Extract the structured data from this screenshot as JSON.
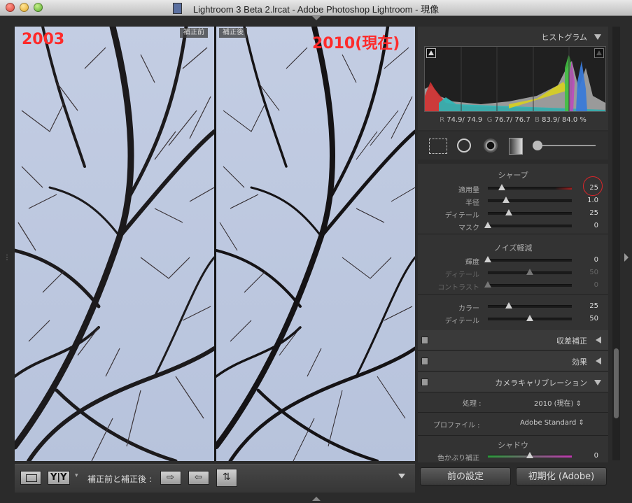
{
  "window": {
    "title": "Lightroom 3 Beta 2.lrcat - Adobe Photoshop Lightroom - 現像"
  },
  "compare": {
    "left_year": "2003",
    "right_year": "2010(現在)",
    "before_label": "補正前",
    "after_label": "補正後"
  },
  "toolbar": {
    "compare_label": "補正前と補正後 :"
  },
  "histogram": {
    "title": "ヒストグラム",
    "r_label": "R",
    "r_value": "74.9/ 74.9",
    "g_label": "G",
    "g_value": "76.7/ 76.7",
    "b_label": "B",
    "b_value": "83.9/ 84.0",
    "percent": "%"
  },
  "detail": {
    "sharpen_title": "シャープ",
    "sharpen": [
      {
        "label": "適用量",
        "value": "25",
        "pos": 0.17
      },
      {
        "label": "半径",
        "value": "1.0",
        "pos": 0.22
      },
      {
        "label": "ディテール",
        "value": "25",
        "pos": 0.25
      },
      {
        "label": "マスク",
        "value": "0",
        "pos": 0.0
      }
    ],
    "noise_title": "ノイズ軽減",
    "noise": [
      {
        "label": "輝度",
        "value": "0",
        "pos": 0.0
      },
      {
        "label": "ディテール",
        "value": "50",
        "pos": 0.5
      },
      {
        "label": "コントラスト",
        "value": "0",
        "pos": 0.0
      }
    ],
    "color": [
      {
        "label": "カラー",
        "value": "25",
        "pos": 0.25
      },
      {
        "label": "ディテール",
        "value": "50",
        "pos": 0.5
      }
    ]
  },
  "panels": {
    "lens": "収差補正",
    "effects": "効果",
    "camera": "カメラキャリブレーション"
  },
  "camera": {
    "process_label": "処理 :",
    "process_value": "2010 (現在)",
    "profile_label": "プロファイル :",
    "profile_value": "Adobe Standard",
    "shadow_title": "シャドウ",
    "tint_label": "色かぶり補正",
    "tint_value": "0",
    "tint_pos": 0.5
  },
  "buttons": {
    "previous": "前の設定",
    "reset": "初期化 (Adobe)"
  },
  "colors": {
    "accent_red": "#ff2a2a",
    "circle_red": "#e0252a"
  }
}
